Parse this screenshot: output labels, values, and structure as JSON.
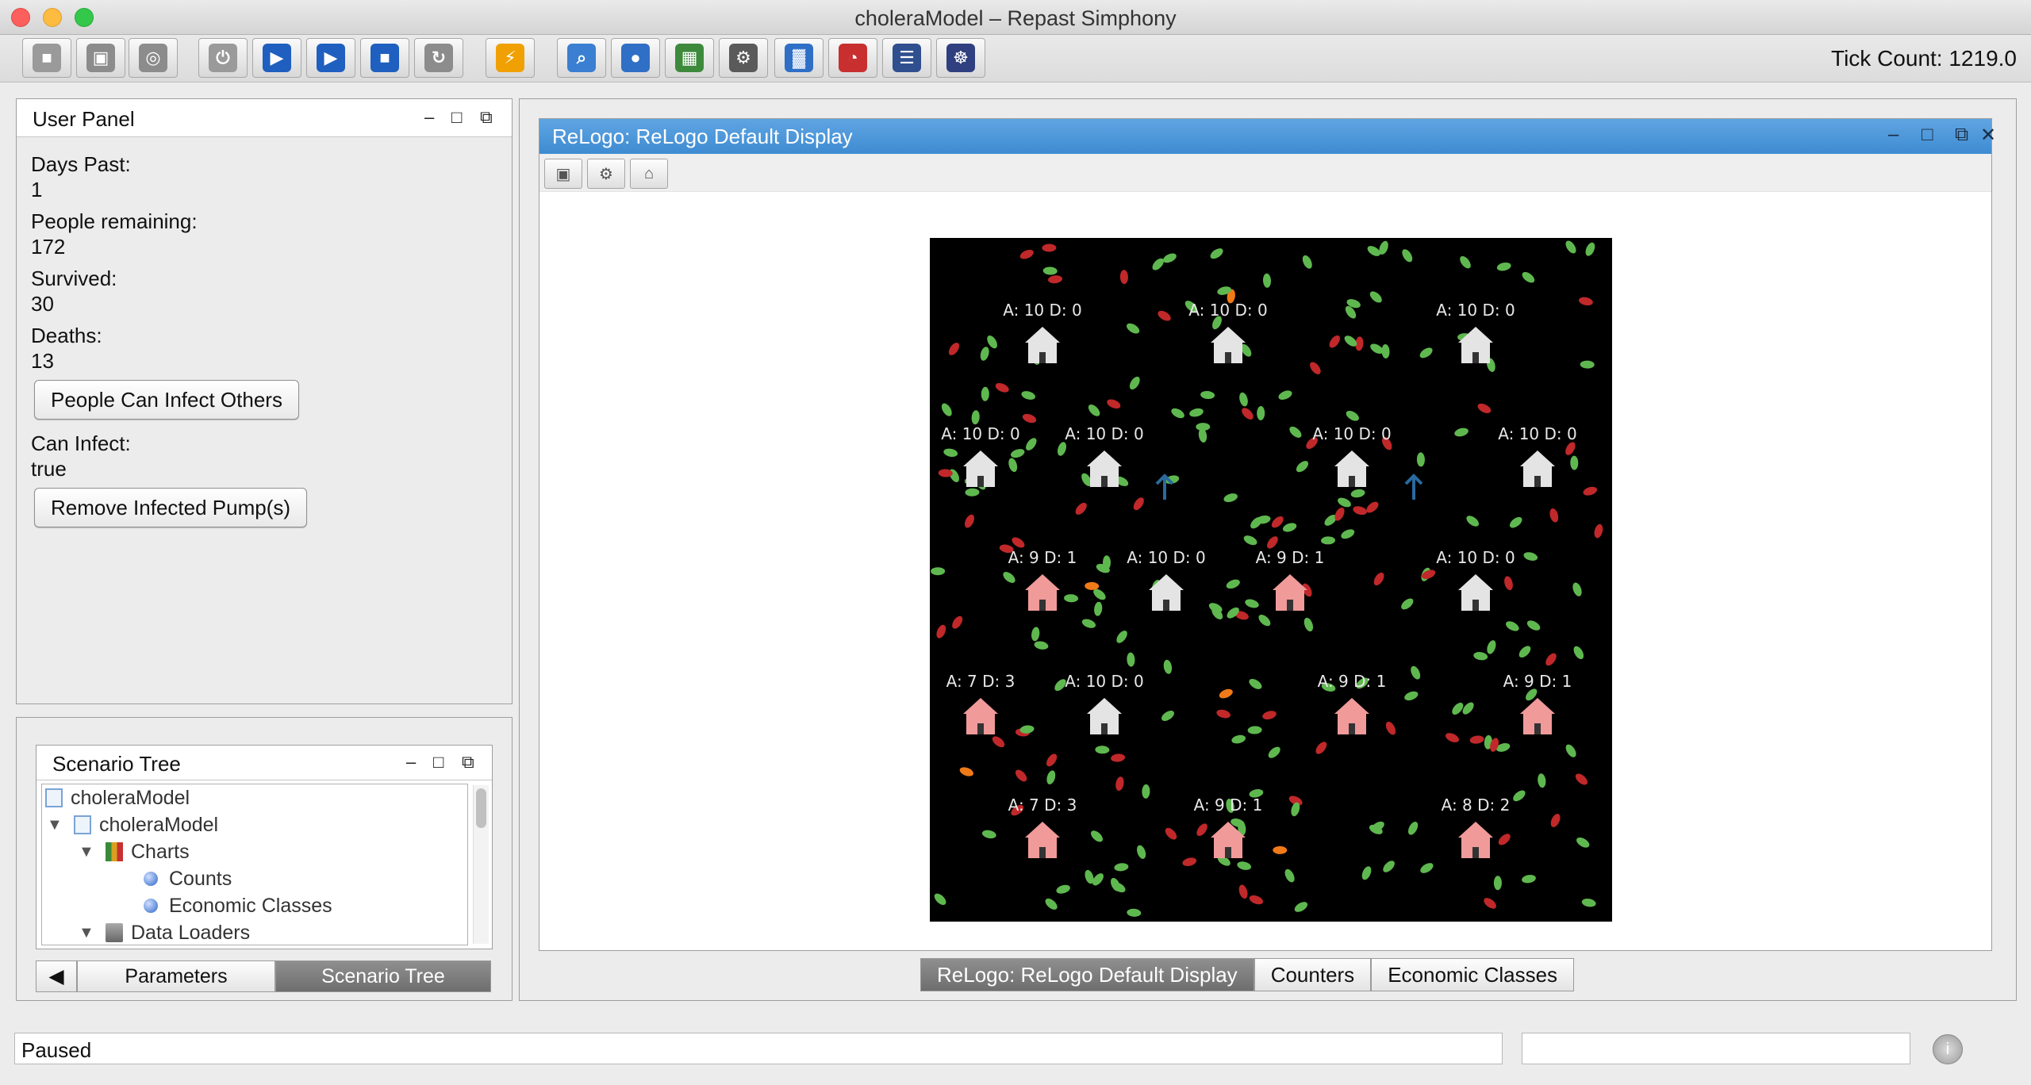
{
  "window": {
    "title": "choleraModel – Repast Simphony"
  },
  "toolbar": {
    "buttons": [
      {
        "name": "new-scenario-icon",
        "color": "#9a9a9a",
        "glyph": "■"
      },
      {
        "name": "save-icon",
        "color": "#8c8c8c",
        "glyph": "▣"
      },
      {
        "name": "database-icon",
        "color": "#8c8c8c",
        "glyph": "◎"
      },
      {
        "name": "power-icon",
        "color": "#9a9a9a",
        "glyph": "⏻"
      },
      {
        "name": "play-icon",
        "color": "#1f5fbf",
        "glyph": "▶"
      },
      {
        "name": "fast-forward-icon",
        "color": "#1f5fbf",
        "glyph": "▶"
      },
      {
        "name": "stop-icon",
        "color": "#1f5fbf",
        "glyph": "■"
      },
      {
        "name": "reset-icon",
        "color": "#8c8c8c",
        "glyph": "↻"
      },
      {
        "name": "run-icon",
        "color": "#f0a000",
        "glyph": "⚡"
      },
      {
        "name": "zoom-icon",
        "color": "#3a7fd1",
        "glyph": "⌕"
      },
      {
        "name": "globe-icon",
        "color": "#2f6fc6",
        "glyph": "●"
      },
      {
        "name": "network-icon",
        "color": "#3d8a3d",
        "glyph": "▦"
      },
      {
        "name": "settings-icon",
        "color": "#5a5a5a",
        "glyph": "⚙"
      },
      {
        "name": "chart-icon",
        "color": "#2f6fc6",
        "glyph": "▓"
      },
      {
        "name": "pie-chart-icon",
        "color": "#c83030",
        "glyph": "◔"
      },
      {
        "name": "calculator-icon",
        "color": "#2f4f8f",
        "glyph": "☰"
      },
      {
        "name": "tractor-icon",
        "color": "#2f3f7f",
        "glyph": "☸"
      }
    ],
    "tick_count": "Tick Count: 1219.0"
  },
  "user_panel": {
    "title": "User Panel",
    "days_past_label": "Days Past:",
    "days_past_value": "1",
    "people_remaining_label": "People remaining:",
    "people_remaining_value": "172",
    "survived_label": "Survived:",
    "survived_value": "30",
    "deaths_label": "Deaths:",
    "deaths_value": "13",
    "infect_button": "People Can Infect Others",
    "can_infect_label": "Can Infect:",
    "can_infect_value": "true",
    "remove_button": "Remove Infected Pump(s)"
  },
  "scenario_tree": {
    "title": "Scenario Tree",
    "root": "choleraModel",
    "child": "choleraModel",
    "charts": "Charts",
    "counts": "Counts",
    "economic_classes": "Economic Classes",
    "data_loaders": "Data Loaders"
  },
  "left_tabs": {
    "parameters": "Parameters",
    "scenario_tree": "Scenario Tree"
  },
  "display": {
    "title": "ReLogo: ReLogo Default Display",
    "houses": [
      {
        "label": "A: 10 D: 0",
        "infected": false,
        "col": 1,
        "row": 0
      },
      {
        "label": "A: 10 D: 0",
        "infected": false,
        "col": 4,
        "row": 0
      },
      {
        "label": "A: 10 D: 0",
        "infected": false,
        "col": 8,
        "row": 0
      },
      {
        "label": "A: 10 D: 0",
        "infected": false,
        "col": 0,
        "row": 1
      },
      {
        "label": "A: 10 D: 0",
        "infected": false,
        "col": 2,
        "row": 1
      },
      {
        "label": "A: 10 D: 0",
        "infected": false,
        "col": 6,
        "row": 1
      },
      {
        "label": "A: 10 D: 0",
        "infected": false,
        "col": 9,
        "row": 1
      },
      {
        "label": "A: 9 D: 1",
        "infected": true,
        "col": 1,
        "row": 2
      },
      {
        "label": "A: 10 D: 0",
        "infected": false,
        "col": 3,
        "row": 2
      },
      {
        "label": "A: 9 D: 1",
        "infected": true,
        "col": 5,
        "row": 2
      },
      {
        "label": "A: 10 D: 0",
        "infected": false,
        "col": 8,
        "row": 2
      },
      {
        "label": "A: 7 D: 3",
        "infected": true,
        "col": 0,
        "row": 3
      },
      {
        "label": "A: 10 D: 0",
        "infected": false,
        "col": 2,
        "row": 3
      },
      {
        "label": "A: 9 D: 1",
        "infected": true,
        "col": 6,
        "row": 3
      },
      {
        "label": "A: 9 D: 1",
        "infected": true,
        "col": 9,
        "row": 3
      },
      {
        "label": "A: 7 D: 3",
        "infected": true,
        "col": 1,
        "row": 4
      },
      {
        "label": "A: 9 D: 1",
        "infected": true,
        "col": 4,
        "row": 4
      },
      {
        "label": "A: 8 D: 2",
        "infected": true,
        "col": 8,
        "row": 4
      }
    ]
  },
  "right_tabs": {
    "display": "ReLogo: ReLogo Default Display",
    "counters": "Counters",
    "economic_classes": "Economic Classes"
  },
  "status": {
    "text": "Paused"
  }
}
